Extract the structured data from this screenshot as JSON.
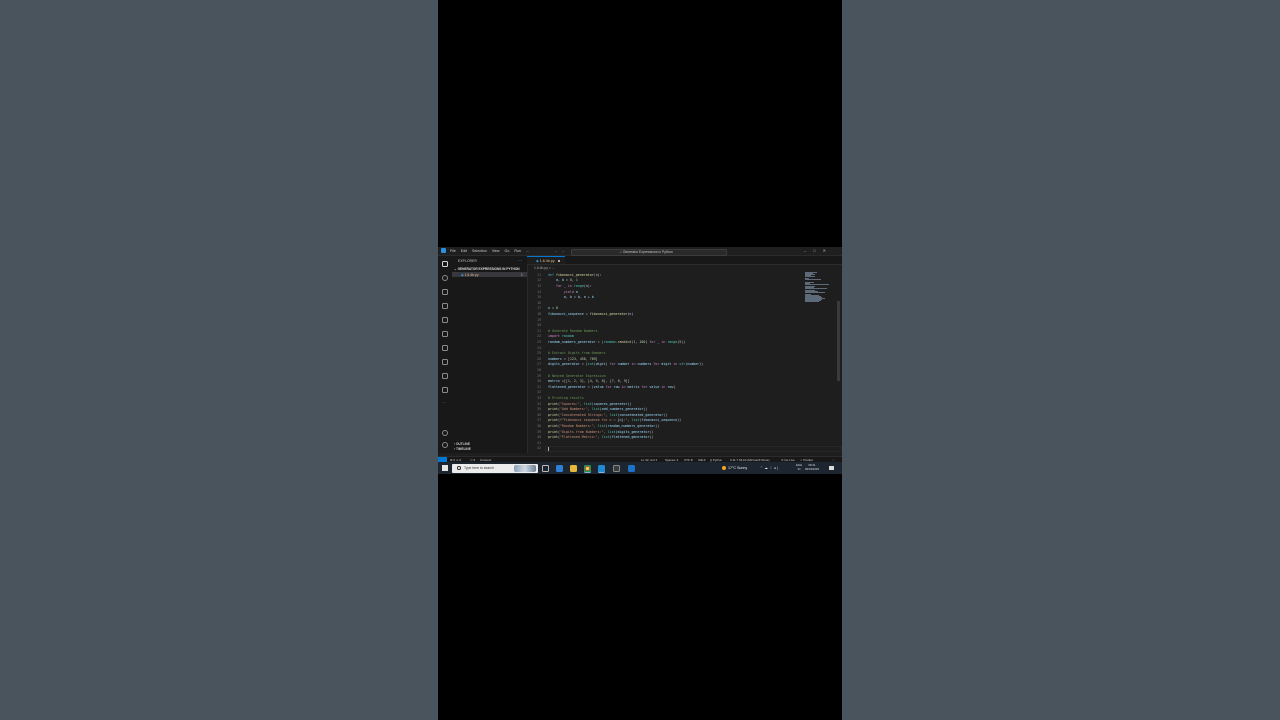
{
  "window": {
    "menus": [
      "File",
      "Edit",
      "Selection",
      "View",
      "Go",
      "Run",
      "..."
    ],
    "search": "Generator Expressions in Python"
  },
  "sidebar": {
    "title": "EXPLORER",
    "folder": "GENERATOR EXPRESSIONS IN PYTHON",
    "file": "1.6.4b.py",
    "file_badge": "1",
    "outline": "OUTLINE",
    "timeline": "TIMELINE"
  },
  "editor": {
    "tab": "1.6.4b.py",
    "breadcrumb": "1.6.4b.py > ...",
    "lines": [
      {
        "n": "11",
        "html": "<span class=\"d\">def</span> <span class=\"f\">fibonacci_generator</span>(<span class=\"v\">n</span>):"
      },
      {
        "n": "12",
        "html": "    <span class=\"v\">a</span>, <span class=\"v\">b</span> = <span class=\"n\">0</span>, <span class=\"n\">1</span>"
      },
      {
        "n": "13",
        "html": "    <span class=\"k\">for</span> <span class=\"v\">_</span> <span class=\"k\">in</span> <span class=\"g\">range</span>(<span class=\"v\">n</span>):"
      },
      {
        "n": "14",
        "html": "        <span class=\"k\">yield</span> <span class=\"v\">a</span>"
      },
      {
        "n": "15",
        "html": "        <span class=\"v\">a</span>, <span class=\"v\">b</span> = <span class=\"v\">b</span>, <span class=\"v\">a</span> + <span class=\"v\">b</span>"
      },
      {
        "n": "16",
        "html": ""
      },
      {
        "n": "17",
        "html": "<span class=\"v\">n</span> = <span class=\"n\">8</span>"
      },
      {
        "n": "18",
        "html": "<span class=\"v\">fibonacci_sequence</span> = <span class=\"f\">fibonacci_generator</span>(<span class=\"v\">n</span>)"
      },
      {
        "n": "19",
        "html": ""
      },
      {
        "n": "20",
        "html": ""
      },
      {
        "n": "21",
        "html": "<span class=\"c\"># Generate Random Numbers</span>"
      },
      {
        "n": "22",
        "html": "<span class=\"k\">import</span> <span class=\"g\">random</span>"
      },
      {
        "n": "23",
        "html": "<span class=\"v\">random_numbers_generator</span> = (<span class=\"g\">random</span>.<span class=\"f\">randint</span>(<span class=\"n\">1</span>, <span class=\"n\">100</span>) <span class=\"k\">for</span> <span class=\"v\">_</span> <span class=\"k\">in</span> <span class=\"g\">range</span>(<span class=\"n\">5</span>))"
      },
      {
        "n": "24",
        "html": ""
      },
      {
        "n": "25",
        "html": "<span class=\"c\"># Extract Digits from Numbers</span>"
      },
      {
        "n": "26",
        "html": "<span class=\"v\">numbers</span> = [<span class=\"n\">123</span>, <span class=\"n\">456</span>, <span class=\"n\">789</span>]"
      },
      {
        "n": "27",
        "html": "<span class=\"v\">digits_generator</span> = (<span class=\"g\">int</span>(<span class=\"v\">digit</span>) <span class=\"k\">for</span> <span class=\"v\">number</span> <span class=\"k\">in</span> <span class=\"v\">numbers</span> <span class=\"k\">for</span> <span class=\"v\">digit</span> <span class=\"k\">in</span> <span class=\"g\">str</span>(<span class=\"v\">number</span>))"
      },
      {
        "n": "28",
        "html": ""
      },
      {
        "n": "29",
        "html": "<span class=\"c\"># Nested Generator Expression</span>"
      },
      {
        "n": "30",
        "html": "<span class=\"v\">matrix</span> =[[<span class=\"n\">1</span>, <span class=\"n\">2</span>, <span class=\"n\">3</span>], [<span class=\"n\">4</span>, <span class=\"n\">5</span>, <span class=\"n\">6</span>], [<span class=\"n\">7</span>, <span class=\"n\">8</span>, <span class=\"n\">9</span>]]"
      },
      {
        "n": "31",
        "html": "<span class=\"v\">flattened_generator</span> = (<span class=\"v\">value</span> <span class=\"k\">for</span> <span class=\"v\">row</span> <span class=\"k\">in</span> <span class=\"v\">matrix</span> <span class=\"k\">for</span> <span class=\"v\">value</span> <span class=\"k\">in</span> <span class=\"v\">row</span>)"
      },
      {
        "n": "32",
        "html": ""
      },
      {
        "n": "33",
        "html": "<span class=\"c\"># Printing results</span>"
      },
      {
        "n": "34",
        "html": "<span class=\"f\">print</span>(<span class=\"s\">\"Squares:\"</span>, <span class=\"g\">list</span>(<span class=\"v\">squares_generator</span>))"
      },
      {
        "n": "35",
        "html": "<span class=\"f\">print</span>(<span class=\"s\">\"Odd Numbers:\"</span>, <span class=\"g\">list</span>(<span class=\"v\">odd_numbers_generator</span>))"
      },
      {
        "n": "36",
        "html": "<span class=\"f\">print</span>(<span class=\"s\">\"Concatenated Strings:\"</span>, <span class=\"g\">list</span>(<span class=\"v\">concatenated_generator</span>))"
      },
      {
        "n": "37",
        "html": "<span class=\"f\">print</span>(<span class=\"s\">f\"Fibonacci sequence for n = </span>{<span class=\"v\">n</span>}<span class=\"s\">:\"</span>, <span class=\"g\">list</span>(<span class=\"v\">fibonacci_sequence</span>))"
      },
      {
        "n": "38",
        "html": "<span class=\"f\">print</span>(<span class=\"s\">\"Random Numbers:\"</span>, <span class=\"g\">list</span>(<span class=\"v\">random_numbers_generator</span>))"
      },
      {
        "n": "39",
        "html": "<span class=\"f\">print</span>(<span class=\"s\">\"Digits from Numbers:\"</span>, <span class=\"g\">list</span>(<span class=\"v\">digits_generator</span>))"
      },
      {
        "n": "40",
        "html": "<span class=\"f\">print</span>(<span class=\"s\">\"Flattened Matrix:\"</span>, <span class=\"g\">list</span>(<span class=\"v\">flattened_generator</span>))"
      },
      {
        "n": "41",
        "html": ""
      },
      {
        "n": "42",
        "html": ""
      }
    ]
  },
  "statusbar": {
    "problems": "⊗ 0 ⚠ 0",
    "ports": "⚇ 0",
    "connect": "Connect",
    "position": "Ln 42, Col 1",
    "spaces": "Spaces: 4",
    "encoding": "UTF-8",
    "eol": "CRLF",
    "language": "{} Python",
    "interpreter": "3.11.7 64-bit (Microsoft Store)",
    "golive": "⊙ Go Live",
    "prettier": "✓ Prettier"
  },
  "taskbar": {
    "search_placeholder": "Type here to search",
    "weather": "17°C  Sunny",
    "lang_line1": "ENG",
    "lang_line2": "IN",
    "time": "08:41",
    "date": "09/03/2025"
  }
}
